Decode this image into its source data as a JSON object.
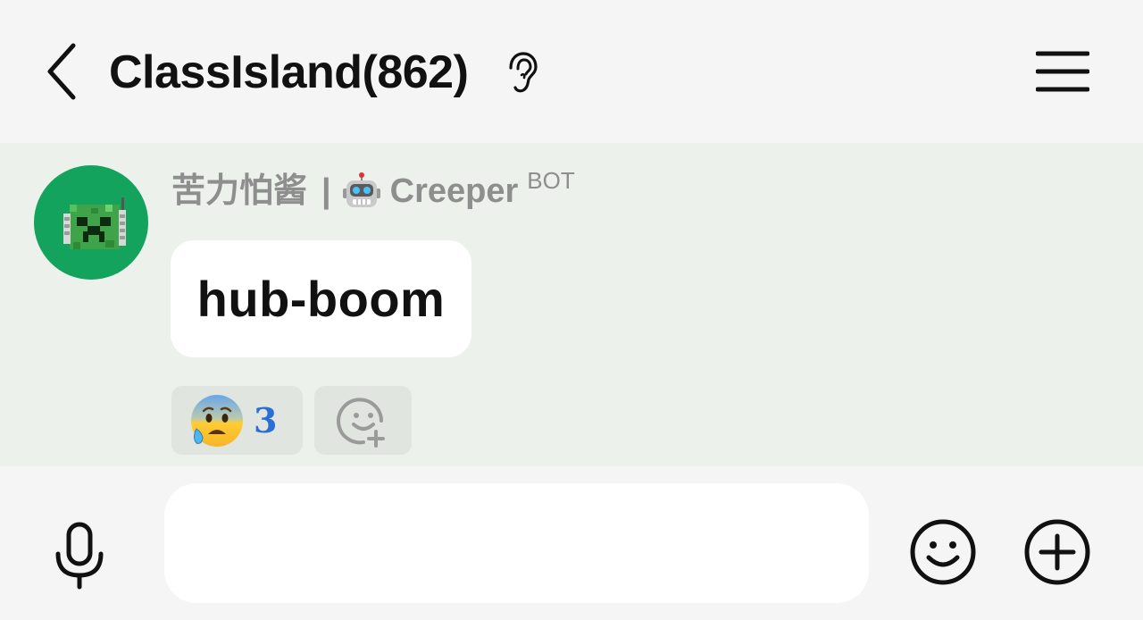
{
  "header": {
    "title": "ClassIsland(862)",
    "back_icon": "chevron-left-icon",
    "listen_icon": "ear-icon",
    "menu_icon": "hamburger-menu-icon"
  },
  "message": {
    "sender_name": "苦力怕酱",
    "separator": "|",
    "sender_emoji": "robot-face-emoji",
    "sender_handle": "Creeper",
    "bot_tag": "BOT",
    "avatar_icon": "creeper-robot-avatar",
    "text": "hub-boom",
    "reactions": [
      {
        "emoji": "anxious-face-with-sweat-emoji",
        "count": "3"
      }
    ],
    "add_reaction_icon": "add-reaction-icon"
  },
  "composer": {
    "mic_icon": "microphone-icon",
    "input_value": "",
    "input_placeholder": "",
    "emoji_icon": "smiley-icon",
    "plus_icon": "plus-circle-icon"
  },
  "colors": {
    "header_bg": "#f5f5f5",
    "chat_bg": "#ecf1ec",
    "avatar_bg": "#14a35c",
    "sender_text": "#8e8e8e",
    "reaction_count": "#2a6fd6",
    "reaction_bg": "#e0e5e0"
  }
}
